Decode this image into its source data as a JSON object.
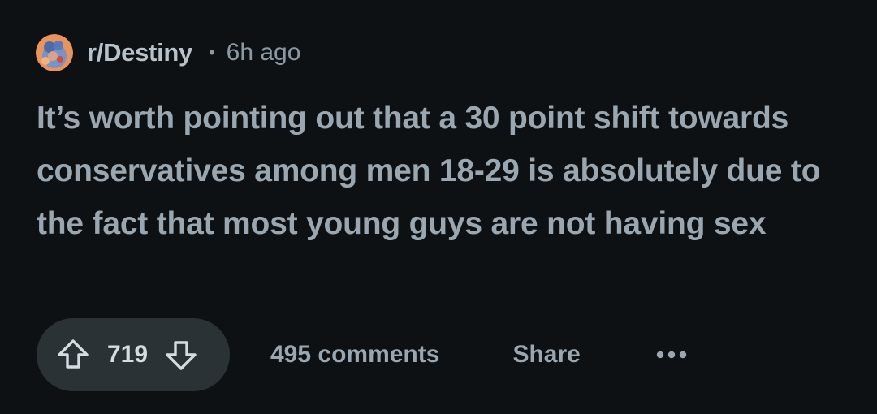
{
  "post": {
    "subreddit": "r/Destiny",
    "separator": "•",
    "age": "6h ago",
    "body": "It’s worth pointing out that a 30 point shift towards conservatives among men 18-29 is absolutely due to the fact that most young guys are not having sex"
  },
  "actions": {
    "score": "719",
    "comments_label": "495 comments",
    "share_label": "Share"
  },
  "icons": {
    "avatar": "subreddit-avatar",
    "upvote": "upvote-arrow-icon",
    "downvote": "downvote-arrow-icon",
    "more": "more-options-icon"
  },
  "colors": {
    "background": "#0e1113",
    "text": "#9aa7b1",
    "pill": "#2a3236"
  }
}
